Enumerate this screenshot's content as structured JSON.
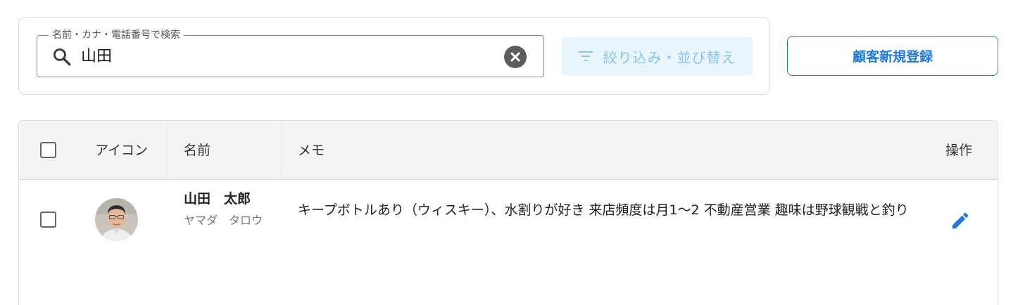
{
  "search": {
    "label": "名前・カナ・電話番号で検索",
    "value": "山田",
    "search_icon": "search-icon",
    "clear_icon": "clear-icon"
  },
  "toolbar": {
    "filter_label": "絞り込み・並び替え",
    "filter_icon": "filter-icon",
    "register_label": "顧客新規登録"
  },
  "table": {
    "columns": {
      "icon": "アイコン",
      "name": "名前",
      "memo": "メモ",
      "actions": "操作"
    },
    "rows": [
      {
        "name": "山田　太郎",
        "kana": "ヤマダ　タロウ",
        "memo": "キープボトルあり（ウィスキー）、水割りが好き 来店頻度は月1〜2 不動産営業 趣味は野球観戦と釣り",
        "avatar_icon": "avatar",
        "action_icon": "edit-icon"
      }
    ]
  },
  "colors": {
    "accent": "#1f79d9",
    "filter_bg": "#e9f5fd",
    "filter_text": "#8cc4ea",
    "header_bg": "#f4f4f4"
  }
}
